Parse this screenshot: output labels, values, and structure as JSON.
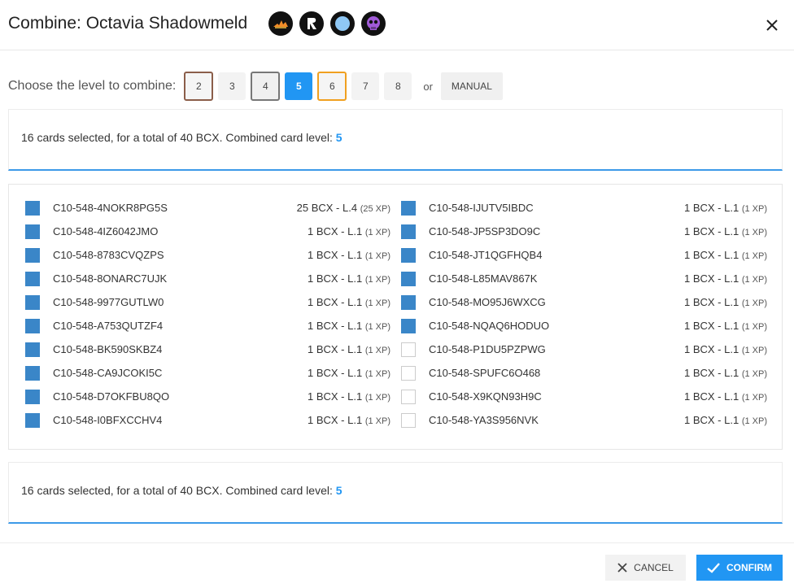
{
  "header": {
    "title": "Combine: Octavia Shadowmeld",
    "badges": [
      "rarity-fire-icon",
      "edition-icon",
      "element-water-icon",
      "skull-icon"
    ]
  },
  "level_selector": {
    "label": "Choose the level to combine:",
    "levels": [
      "2",
      "3",
      "4",
      "5",
      "6",
      "7",
      "8"
    ],
    "selected": "5",
    "or_text": "or",
    "manual_label": "MANUAL"
  },
  "summary": {
    "text": "16 cards selected, for a total of 40 BCX. Combined card level: ",
    "level": "5"
  },
  "cards": {
    "left": [
      {
        "id": "C10-548-4NOKR8PG5S",
        "bcx": "25 BCX - L.4",
        "xp": "(25 XP)",
        "checked": true
      },
      {
        "id": "C10-548-4IZ6042JMO",
        "bcx": "1 BCX - L.1",
        "xp": "(1 XP)",
        "checked": true
      },
      {
        "id": "C10-548-8783CVQZPS",
        "bcx": "1 BCX - L.1",
        "xp": "(1 XP)",
        "checked": true
      },
      {
        "id": "C10-548-8ONARC7UJK",
        "bcx": "1 BCX - L.1",
        "xp": "(1 XP)",
        "checked": true
      },
      {
        "id": "C10-548-9977GUTLW0",
        "bcx": "1 BCX - L.1",
        "xp": "(1 XP)",
        "checked": true
      },
      {
        "id": "C10-548-A753QUTZF4",
        "bcx": "1 BCX - L.1",
        "xp": "(1 XP)",
        "checked": true
      },
      {
        "id": "C10-548-BK590SKBZ4",
        "bcx": "1 BCX - L.1",
        "xp": "(1 XP)",
        "checked": true
      },
      {
        "id": "C10-548-CA9JCOKI5C",
        "bcx": "1 BCX - L.1",
        "xp": "(1 XP)",
        "checked": true
      },
      {
        "id": "C10-548-D7OKFBU8QO",
        "bcx": "1 BCX - L.1",
        "xp": "(1 XP)",
        "checked": true
      },
      {
        "id": "C10-548-I0BFXCCHV4",
        "bcx": "1 BCX - L.1",
        "xp": "(1 XP)",
        "checked": true
      }
    ],
    "right": [
      {
        "id": "C10-548-IJUTV5IBDC",
        "bcx": "1 BCX - L.1",
        "xp": "(1 XP)",
        "checked": true
      },
      {
        "id": "C10-548-JP5SP3DO9C",
        "bcx": "1 BCX - L.1",
        "xp": "(1 XP)",
        "checked": true
      },
      {
        "id": "C10-548-JT1QGFHQB4",
        "bcx": "1 BCX - L.1",
        "xp": "(1 XP)",
        "checked": true
      },
      {
        "id": "C10-548-L85MAV867K",
        "bcx": "1 BCX - L.1",
        "xp": "(1 XP)",
        "checked": true
      },
      {
        "id": "C10-548-MO95J6WXCG",
        "bcx": "1 BCX - L.1",
        "xp": "(1 XP)",
        "checked": true
      },
      {
        "id": "C10-548-NQAQ6HODUO",
        "bcx": "1 BCX - L.1",
        "xp": "(1 XP)",
        "checked": true
      },
      {
        "id": "C10-548-P1DU5PZPWG",
        "bcx": "1 BCX - L.1",
        "xp": "(1 XP)",
        "checked": false
      },
      {
        "id": "C10-548-SPUFC6O468",
        "bcx": "1 BCX - L.1",
        "xp": "(1 XP)",
        "checked": false
      },
      {
        "id": "C10-548-X9KQN93H9C",
        "bcx": "1 BCX - L.1",
        "xp": "(1 XP)",
        "checked": false
      },
      {
        "id": "C10-548-YA3S956NVK",
        "bcx": "1 BCX - L.1",
        "xp": "(1 XP)",
        "checked": false
      }
    ]
  },
  "footer": {
    "cancel_label": "CANCEL",
    "confirm_label": "CONFIRM"
  },
  "colors": {
    "accent": "#2196f3",
    "checkbox_checked": "#3a86c8",
    "level2_outline": "#8b5e4a",
    "level4_outline": "#777777",
    "level6_outline": "#f0a020"
  }
}
